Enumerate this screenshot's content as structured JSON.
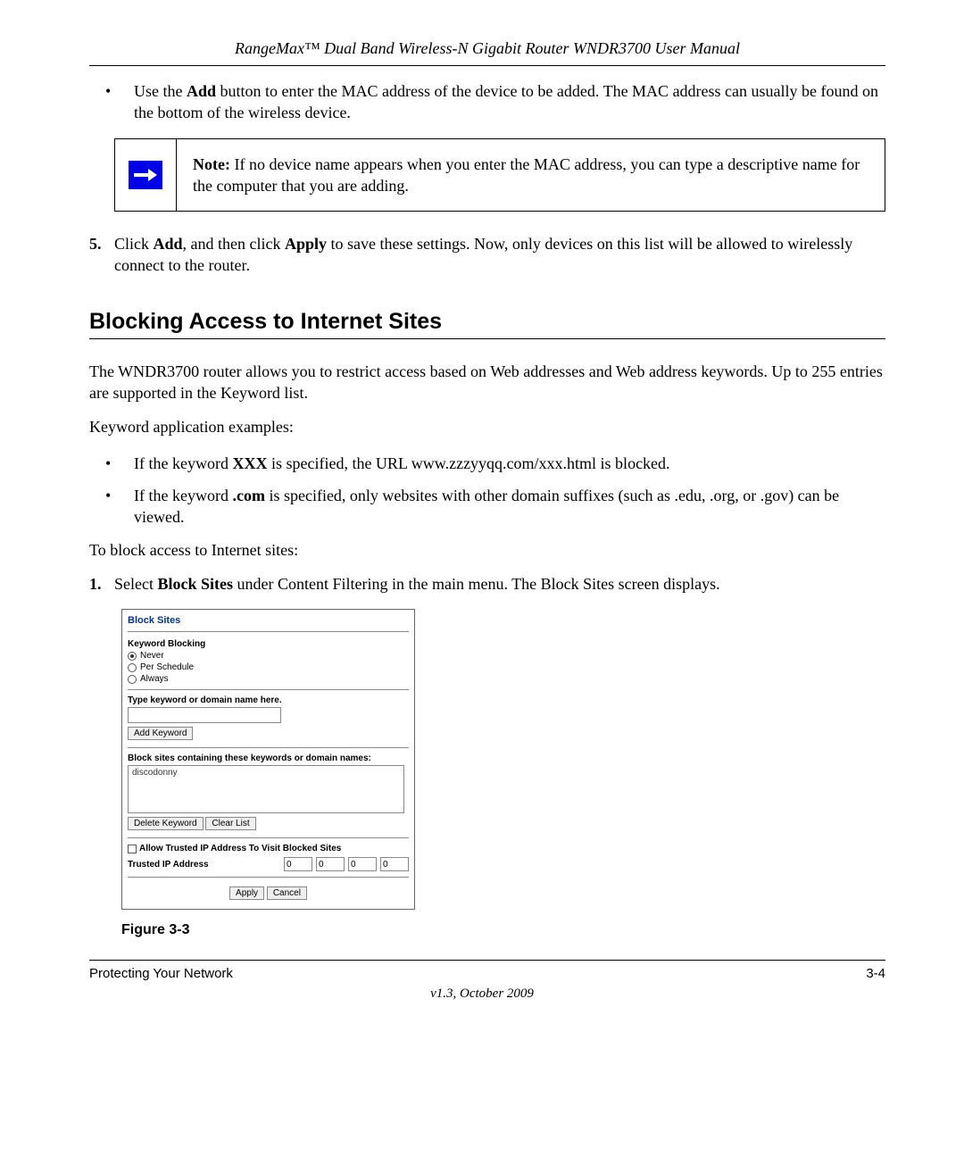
{
  "header": {
    "title": "RangeMax™ Dual Band Wireless-N Gigabit Router WNDR3700 User Manual"
  },
  "bullet_add": {
    "pre": "Use the ",
    "bold": "Add",
    "post": " button to enter the MAC address of the device to be added. The MAC address can usually be found on the bottom of the wireless device."
  },
  "note": {
    "label": "Note:",
    "text": " If no device name appears when you enter the MAC address, you can type a descriptive name for the computer that you are adding."
  },
  "step5": {
    "num": "5.",
    "t1": "Click ",
    "b1": "Add",
    "t2": ", and then click ",
    "b2": "Apply",
    "t3": " to save these settings. Now, only devices on this list will be allowed to wirelessly connect to the router."
  },
  "section_heading": "Blocking Access to Internet Sites",
  "intro_para": "The WNDR3700 router allows you to restrict access based on Web addresses and Web address keywords. Up to 255 entries are supported in the Keyword list.",
  "examples_label": "Keyword application examples:",
  "ex1": {
    "t1": "If the keyword ",
    "b1": "XXX",
    "t2": " is specified, the URL www.zzzyyqq.com/xxx.html is blocked."
  },
  "ex2": {
    "t1": "If the keyword ",
    "b1": ".com",
    "t2": " is specified, only websites with other domain suffixes (such as .edu, .org, or .gov) can be viewed."
  },
  "to_block_label": "To block access to Internet sites:",
  "step1": {
    "num": "1.",
    "t1": "Select ",
    "b1": "Block Sites",
    "t2": " under Content Filtering in the main menu. The Block Sites screen displays."
  },
  "screenshot": {
    "title": "Block Sites",
    "keyword_blocking": "Keyword Blocking",
    "radio_never": "Never",
    "radio_per_schedule": "Per Schedule",
    "radio_always": "Always",
    "type_keyword_label": "Type keyword or domain name here.",
    "add_keyword": "Add Keyword",
    "block_sites_label": "Block sites containing these keywords or domain names:",
    "list_item": "discodonny",
    "delete_keyword": "Delete Keyword",
    "clear_list": "Clear List",
    "allow_trusted": "Allow Trusted IP Address To Visit Blocked Sites",
    "trusted_ip_label": "Trusted IP Address",
    "ip": [
      "0",
      "0",
      "0",
      "0"
    ],
    "apply": "Apply",
    "cancel": "Cancel"
  },
  "figure_caption": "Figure 3-3",
  "footer": {
    "left": "Protecting Your Network",
    "right": "3-4",
    "version": "v1.3, October 2009"
  }
}
